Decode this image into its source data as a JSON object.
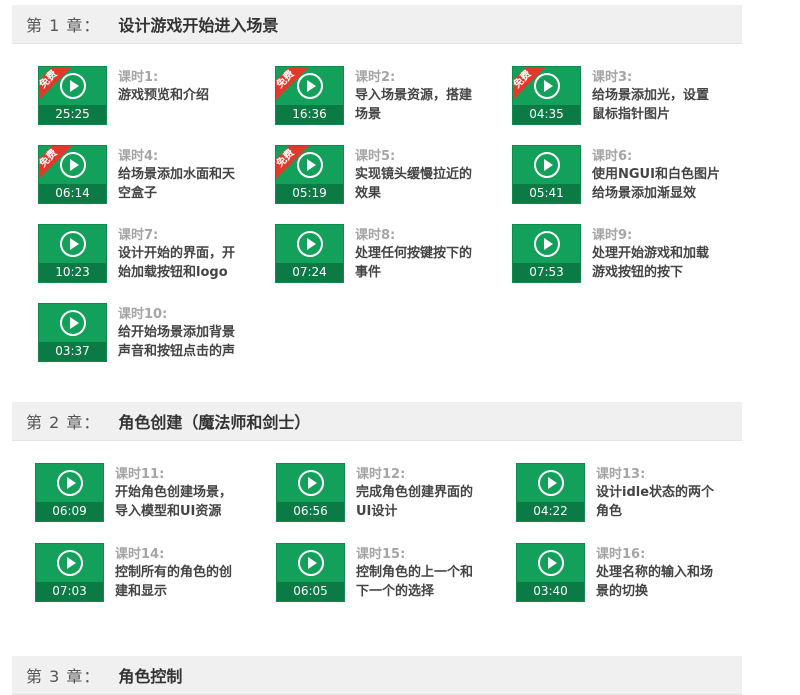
{
  "chapters": [
    {
      "number": "第 1 章：",
      "title": "设计游戏开始进入场景"
    },
    {
      "number": "第 2 章：",
      "title": "角色创建（魔法师和剑士）"
    },
    {
      "number": "第 3 章：",
      "title": "角色控制"
    }
  ],
  "free_badge": "免费",
  "lessons": [
    {
      "label": "课时1:",
      "desc": "游戏预览和介绍",
      "duration": "25:25",
      "free": true
    },
    {
      "label": "课时2:",
      "desc": "导入场景资源，搭建场景",
      "duration": "16:36",
      "free": true
    },
    {
      "label": "课时3:",
      "desc": "给场景添加光，设置鼠标指针图片",
      "duration": "04:35",
      "free": true
    },
    {
      "label": "课时4:",
      "desc": "给场景添加水面和天空盒子",
      "duration": "06:14",
      "free": true
    },
    {
      "label": "课时5:",
      "desc": "实现镜头缓慢拉近的效果",
      "duration": "05:19",
      "free": true
    },
    {
      "label": "课时6:",
      "desc": "使用NGUI和白色图片给场景添加渐显效",
      "duration": "05:41",
      "free": false
    },
    {
      "label": "课时7:",
      "desc": "设计开始的界面，开始加载按钮和logo",
      "duration": "10:23",
      "free": false
    },
    {
      "label": "课时8:",
      "desc": "处理任何按键按下的事件",
      "duration": "07:24",
      "free": false
    },
    {
      "label": "课时9:",
      "desc": "处理开始游戏和加载游戏按钮的按下",
      "duration": "07:53",
      "free": false
    },
    {
      "label": "课时10:",
      "desc": "给开始场景添加背景声音和按钮点击的声",
      "duration": "03:37",
      "free": false
    },
    {
      "label": "课时11:",
      "desc": "开始角色创建场景，导入模型和UI资源",
      "duration": "06:09",
      "free": false
    },
    {
      "label": "课时12:",
      "desc": "完成角色创建界面的UI设计",
      "duration": "06:56",
      "free": false
    },
    {
      "label": "课时13:",
      "desc": "设计idle状态的两个角色",
      "duration": "04:22",
      "free": false
    },
    {
      "label": "课时14:",
      "desc": "控制所有的角色的创建和显示",
      "duration": "07:03",
      "free": false
    },
    {
      "label": "课时15:",
      "desc": "控制角色的上一个和下一个的选择",
      "duration": "06:05",
      "free": false
    },
    {
      "label": "课时16:",
      "desc": "处理名称的输入和场景的切换",
      "duration": "03:40",
      "free": false
    }
  ],
  "colors": {
    "thumb_green": "#13a05a",
    "free_red": "#e03a2a",
    "chapter_bg": "#f0f0f0"
  }
}
